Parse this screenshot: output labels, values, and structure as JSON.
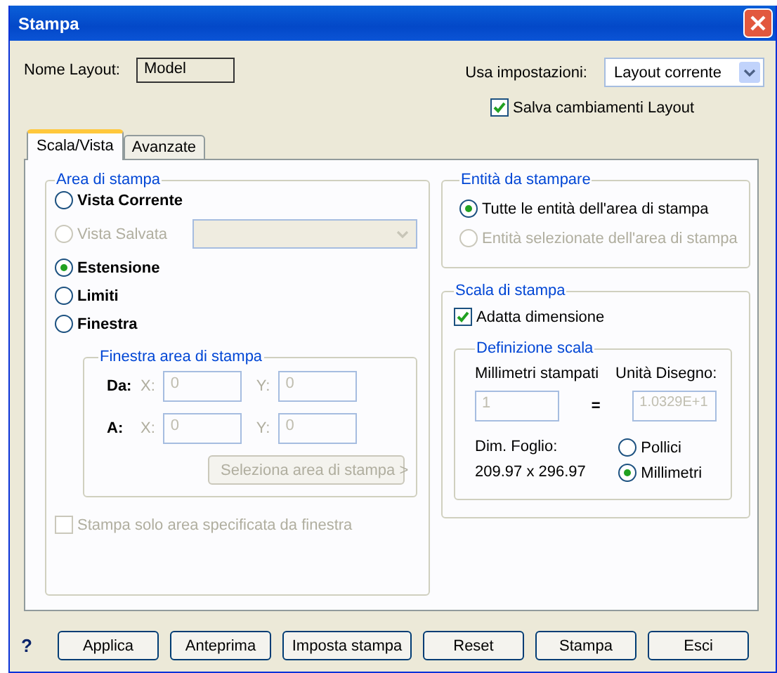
{
  "window": {
    "title": "Stampa"
  },
  "layout_name": {
    "label": "Nome Layout:",
    "value": "Model"
  },
  "settings": {
    "label": "Usa impostazioni:",
    "value": "Layout corrente"
  },
  "save_changes": {
    "label": "Salva cambiamenti Layout",
    "checked": true
  },
  "tabs": [
    {
      "label": "Scala/Vista",
      "selected": true
    },
    {
      "label": "Avanzate",
      "selected": false
    }
  ],
  "print_area": {
    "title": "Area di stampa",
    "options": [
      {
        "label": "Vista Corrente",
        "selected": false,
        "disabled": false
      },
      {
        "label": "Vista Salvata",
        "selected": false,
        "disabled": true,
        "kind": "dropdown"
      },
      {
        "label": "Estensione",
        "selected": true,
        "disabled": false
      },
      {
        "label": "Limiti",
        "selected": false,
        "disabled": false
      },
      {
        "label": "Finestra",
        "selected": false,
        "disabled": false
      }
    ],
    "window_area": {
      "title": "Finestra area di stampa",
      "rows": [
        {
          "label": "Da:",
          "x_label": "X:",
          "x_value": "0",
          "y_label": "Y:",
          "y_value": "0"
        },
        {
          "label": "A:",
          "x_label": "X:",
          "x_value": "0",
          "y_label": "Y:",
          "y_value": "0"
        }
      ],
      "button": "Seleziona area di stampa >"
    },
    "only_window": {
      "label": "Stampa solo area specificata da finestra",
      "checked": false,
      "disabled": true
    }
  },
  "entities": {
    "title": "Entità da stampare",
    "options": [
      {
        "label": "Tutte le entità dell'area di stampa",
        "selected": true,
        "disabled": false
      },
      {
        "label": "Entità selezionate dell'area di stampa",
        "selected": false,
        "disabled": true
      }
    ]
  },
  "scale": {
    "title": "Scala di stampa",
    "fit": {
      "label": "Adatta dimensione",
      "checked": true
    },
    "definition": {
      "title": "Definizione scala",
      "mm_label": "Millimetri stampati",
      "units_label": "Unità Disegno:",
      "mm_value": "1",
      "equals": "=",
      "units_value": "1.0329E+1",
      "sheet_label": "Dim. Foglio:",
      "sheet_value": "209.97 x 296.97",
      "units": [
        {
          "label": "Pollici",
          "selected": false
        },
        {
          "label": "Millimetri",
          "selected": true
        }
      ]
    }
  },
  "help": "?",
  "buttons": [
    "Applica",
    "Anteprima",
    "Imposta stampa",
    "Reset",
    "Stampa",
    "Esci"
  ]
}
